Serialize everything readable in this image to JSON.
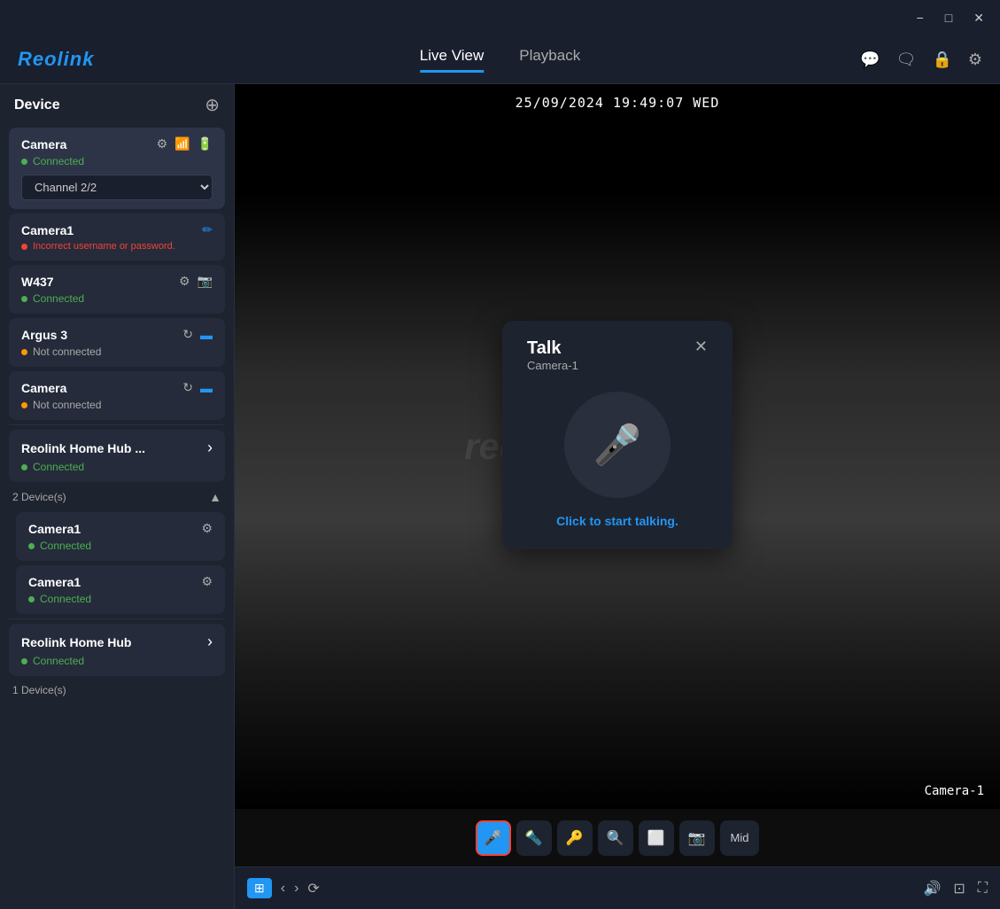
{
  "titleBar": {
    "minimizeLabel": "−",
    "maximizeLabel": "□",
    "closeLabel": "✕"
  },
  "topNav": {
    "logo": "Reolink",
    "tabs": [
      {
        "label": "Live View",
        "active": true
      },
      {
        "label": "Playback",
        "active": false
      }
    ],
    "icons": [
      "chat-icon",
      "message-icon",
      "lock-icon",
      "settings-icon"
    ]
  },
  "sidebar": {
    "title": "Device",
    "devices": [
      {
        "name": "Camera",
        "status": "Connected",
        "statusType": "connected",
        "channel": "Channel 2/2",
        "icons": [
          "gear",
          "wifi",
          "battery"
        ],
        "hasChannel": true,
        "isActive": true
      },
      {
        "name": "Camera1",
        "status": "Incorrect username or password.",
        "statusType": "error",
        "icons": [
          "edit"
        ],
        "hasChannel": false,
        "isActive": false
      },
      {
        "name": "W437",
        "status": "Connected",
        "statusType": "connected",
        "icons": [
          "gear",
          "camera"
        ],
        "hasChannel": false,
        "isActive": false
      },
      {
        "name": "Argus 3",
        "status": "Not connected",
        "statusType": "notconnected",
        "icons": [
          "refresh",
          "battery-blue"
        ],
        "hasChannel": false,
        "isActive": false
      },
      {
        "name": "Camera",
        "status": "Not connected",
        "statusType": "notconnected",
        "icons": [
          "refresh",
          "battery-blue"
        ],
        "hasChannel": false,
        "isActive": false
      }
    ],
    "groups": [
      {
        "name": "Reolink Home Hub ...",
        "status": "Connected",
        "statusType": "connected",
        "deviceCount": "2 Device(s)",
        "expanded": true,
        "subDevices": [
          {
            "name": "Camera1",
            "status": "Connected",
            "statusType": "connected"
          },
          {
            "name": "Camera1",
            "status": "Connected",
            "statusType": "connected"
          }
        ]
      },
      {
        "name": "Reolink Home Hub",
        "status": "Connected",
        "statusType": "connected",
        "deviceCount": "1 Device(s)",
        "expanded": false,
        "subDevices": []
      }
    ]
  },
  "video": {
    "timestamp": "25/09/2024  19:49:07  WED",
    "cameraLabel": "Camera-1",
    "watermark": "reolink"
  },
  "talkDialog": {
    "title": "Talk",
    "subtitle": "Camera-1",
    "ctaText": "Click to start talking.",
    "closeLabel": "✕"
  },
  "bottomToolbar": {
    "buttons": [
      {
        "id": "mic",
        "label": "🎤",
        "active": true
      },
      {
        "id": "light",
        "label": "🔦",
        "active": false
      },
      {
        "id": "key",
        "label": "🔑",
        "active": false
      },
      {
        "id": "zoom",
        "label": "🔍",
        "active": false
      },
      {
        "id": "screen",
        "label": "⬜",
        "active": false
      },
      {
        "id": "snapshot",
        "label": "📷",
        "active": false
      },
      {
        "id": "quality",
        "label": "Mid",
        "active": false
      }
    ]
  },
  "bottomNav": {
    "leftButtons": [
      {
        "id": "grid",
        "label": "⊞",
        "active": true
      },
      {
        "id": "prev",
        "label": "‹",
        "active": false
      },
      {
        "id": "next",
        "label": "›",
        "active": false
      },
      {
        "id": "refresh",
        "label": "⟳",
        "active": false
      }
    ],
    "rightButtons": [
      {
        "id": "volume",
        "label": "🔊",
        "active": false
      },
      {
        "id": "pip",
        "label": "⊡",
        "active": false
      },
      {
        "id": "fullscreen",
        "label": "⛶",
        "active": false
      }
    ]
  }
}
